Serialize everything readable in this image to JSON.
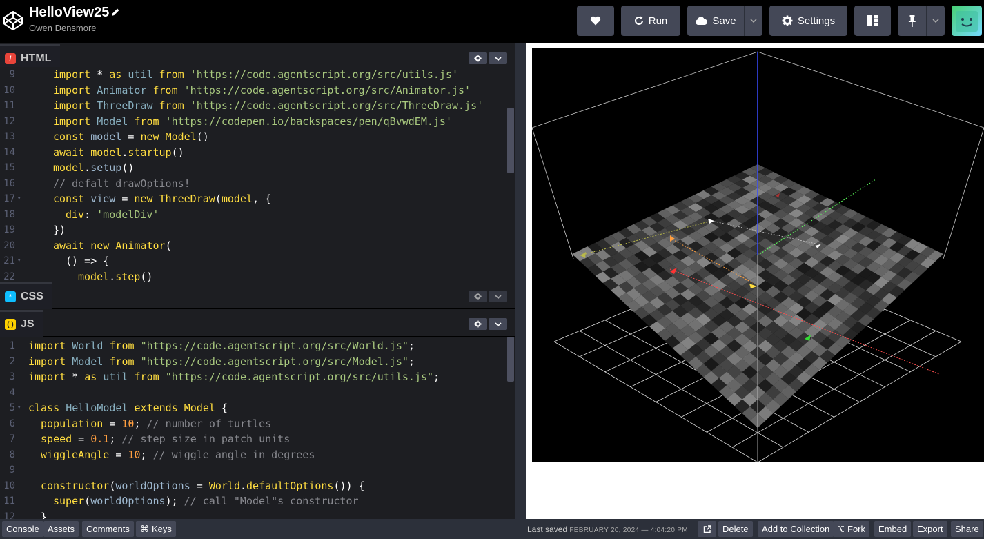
{
  "pen": {
    "title": "HelloView25",
    "author": "Owen Densmore"
  },
  "header_buttons": {
    "heart": "heart-icon",
    "run": "Run",
    "save": "Save",
    "settings": "Settings",
    "layout": "layout-icon",
    "pin": "pin-icon"
  },
  "panels": {
    "html": "HTML",
    "css": "CSS",
    "js": "JS"
  },
  "html_code": [
    {
      "n": "9",
      "fold": "",
      "indent": 2,
      "tokens": [
        [
          "kw",
          "import"
        ],
        [
          "punc",
          " * "
        ],
        [
          "kw",
          "as"
        ],
        [
          "punc",
          " "
        ],
        [
          "cls",
          "util"
        ],
        [
          "punc",
          " "
        ],
        [
          "kw",
          "from"
        ],
        [
          "punc",
          " "
        ],
        [
          "str",
          "'https://code.agentscript.org/src/utils.js'"
        ]
      ]
    },
    {
      "n": "10",
      "fold": "",
      "indent": 2,
      "tokens": [
        [
          "kw",
          "import"
        ],
        [
          "punc",
          " "
        ],
        [
          "cls",
          "Animator"
        ],
        [
          "punc",
          " "
        ],
        [
          "kw",
          "from"
        ],
        [
          "punc",
          " "
        ],
        [
          "str",
          "'https://code.agentscript.org/src/Animator.js'"
        ]
      ]
    },
    {
      "n": "11",
      "fold": "",
      "indent": 2,
      "tokens": [
        [
          "kw",
          "import"
        ],
        [
          "punc",
          " "
        ],
        [
          "cls",
          "ThreeDraw"
        ],
        [
          "punc",
          " "
        ],
        [
          "kw",
          "from"
        ],
        [
          "punc",
          " "
        ],
        [
          "str",
          "'https://code.agentscript.org/src/ThreeDraw.js'"
        ]
      ]
    },
    {
      "n": "12",
      "fold": "",
      "indent": 2,
      "tokens": [
        [
          "kw",
          "import"
        ],
        [
          "punc",
          " "
        ],
        [
          "cls",
          "Model"
        ],
        [
          "punc",
          " "
        ],
        [
          "kw",
          "from"
        ],
        [
          "punc",
          " "
        ],
        [
          "str",
          "'https://codepen.io/backspaces/pen/qBvwdEM.js'"
        ]
      ]
    },
    {
      "n": "13",
      "fold": "",
      "indent": 2,
      "tokens": [
        [
          "kw",
          "const"
        ],
        [
          "punc",
          " "
        ],
        [
          "var",
          "model"
        ],
        [
          "punc",
          " = "
        ],
        [
          "kw",
          "new"
        ],
        [
          "punc",
          " "
        ],
        [
          "fn",
          "Model"
        ],
        [
          "punc",
          "()"
        ]
      ]
    },
    {
      "n": "14",
      "fold": "",
      "indent": 2,
      "tokens": [
        [
          "kw",
          "await"
        ],
        [
          "punc",
          " "
        ],
        [
          "fn",
          "model"
        ],
        [
          "punc",
          "."
        ],
        [
          "fn",
          "startup"
        ],
        [
          "punc",
          "()"
        ]
      ]
    },
    {
      "n": "15",
      "fold": "",
      "indent": 2,
      "tokens": [
        [
          "fn",
          "model"
        ],
        [
          "punc",
          "."
        ],
        [
          "var",
          "setup"
        ],
        [
          "punc",
          "()"
        ]
      ]
    },
    {
      "n": "16",
      "fold": "",
      "indent": 2,
      "tokens": [
        [
          "cm",
          "// defalt drawOptions!"
        ]
      ]
    },
    {
      "n": "17",
      "fold": "▾",
      "indent": 2,
      "tokens": [
        [
          "kw",
          "const"
        ],
        [
          "punc",
          " "
        ],
        [
          "var",
          "view"
        ],
        [
          "punc",
          " = "
        ],
        [
          "kw",
          "new"
        ],
        [
          "punc",
          " "
        ],
        [
          "fn",
          "ThreeDraw"
        ],
        [
          "punc",
          "("
        ],
        [
          "fn",
          "model"
        ],
        [
          "punc",
          ", {"
        ]
      ]
    },
    {
      "n": "18",
      "fold": "",
      "indent": 3,
      "tokens": [
        [
          "fn",
          "div"
        ],
        [
          "punc",
          ": "
        ],
        [
          "str",
          "'modelDiv'"
        ]
      ]
    },
    {
      "n": "19",
      "fold": "",
      "indent": 2,
      "tokens": [
        [
          "punc",
          "})"
        ]
      ]
    },
    {
      "n": "20",
      "fold": "",
      "indent": 2,
      "tokens": [
        [
          "kw",
          "await"
        ],
        [
          "punc",
          " "
        ],
        [
          "kw",
          "new"
        ],
        [
          "punc",
          " "
        ],
        [
          "fn",
          "Animator"
        ],
        [
          "punc",
          "("
        ]
      ]
    },
    {
      "n": "21",
      "fold": "▾",
      "indent": 3,
      "tokens": [
        [
          "punc",
          "() => {"
        ]
      ]
    },
    {
      "n": "22",
      "fold": "",
      "indent": 4,
      "tokens": [
        [
          "fn",
          "model"
        ],
        [
          "punc",
          "."
        ],
        [
          "fn",
          "step"
        ],
        [
          "punc",
          "()"
        ]
      ]
    }
  ],
  "js_code": [
    {
      "n": "1",
      "fold": "",
      "indent": 0,
      "tokens": [
        [
          "kw",
          "import"
        ],
        [
          "punc",
          " "
        ],
        [
          "cls",
          "World"
        ],
        [
          "punc",
          " "
        ],
        [
          "kw",
          "from"
        ],
        [
          "punc",
          " "
        ],
        [
          "str",
          "\"https://code.agentscript.org/src/World.js\""
        ],
        [
          "punc",
          ";"
        ]
      ]
    },
    {
      "n": "2",
      "fold": "",
      "indent": 0,
      "tokens": [
        [
          "kw",
          "import"
        ],
        [
          "punc",
          " "
        ],
        [
          "cls",
          "Model"
        ],
        [
          "punc",
          " "
        ],
        [
          "kw",
          "from"
        ],
        [
          "punc",
          " "
        ],
        [
          "str",
          "\"https://code.agentscript.org/src/Model.js\""
        ],
        [
          "punc",
          ";"
        ]
      ]
    },
    {
      "n": "3",
      "fold": "",
      "indent": 0,
      "tokens": [
        [
          "kw",
          "import"
        ],
        [
          "punc",
          " * "
        ],
        [
          "kw",
          "as"
        ],
        [
          "punc",
          " "
        ],
        [
          "cls",
          "util"
        ],
        [
          "punc",
          " "
        ],
        [
          "kw",
          "from"
        ],
        [
          "punc",
          " "
        ],
        [
          "str",
          "\"https://code.agentscript.org/src/utils.js\""
        ],
        [
          "punc",
          ";"
        ]
      ]
    },
    {
      "n": "4",
      "fold": "",
      "indent": 0,
      "tokens": []
    },
    {
      "n": "5",
      "fold": "▾",
      "indent": 0,
      "tokens": [
        [
          "kw",
          "class"
        ],
        [
          "punc",
          " "
        ],
        [
          "cls",
          "HelloModel"
        ],
        [
          "punc",
          " "
        ],
        [
          "kw",
          "extends"
        ],
        [
          "punc",
          " "
        ],
        [
          "fn",
          "Model"
        ],
        [
          "punc",
          " {"
        ]
      ]
    },
    {
      "n": "6",
      "fold": "",
      "indent": 1,
      "tokens": [
        [
          "fn",
          "population"
        ],
        [
          "punc",
          " = "
        ],
        [
          "num",
          "10"
        ],
        [
          "punc",
          "; "
        ],
        [
          "cm",
          "// number of turtles"
        ]
      ]
    },
    {
      "n": "7",
      "fold": "",
      "indent": 1,
      "tokens": [
        [
          "fn",
          "speed"
        ],
        [
          "punc",
          " = "
        ],
        [
          "num",
          "0.1"
        ],
        [
          "punc",
          "; "
        ],
        [
          "cm",
          "// step size in patch units"
        ]
      ]
    },
    {
      "n": "8",
      "fold": "",
      "indent": 1,
      "tokens": [
        [
          "fn",
          "wiggleAngle"
        ],
        [
          "punc",
          " = "
        ],
        [
          "num",
          "10"
        ],
        [
          "punc",
          "; "
        ],
        [
          "cm",
          "// wiggle angle in degrees"
        ]
      ]
    },
    {
      "n": "9",
      "fold": "",
      "indent": 0,
      "tokens": []
    },
    {
      "n": "10",
      "fold": "",
      "indent": 1,
      "tokens": [
        [
          "fn",
          "constructor"
        ],
        [
          "punc",
          "("
        ],
        [
          "var",
          "worldOptions"
        ],
        [
          "punc",
          " = "
        ],
        [
          "fn",
          "World"
        ],
        [
          "punc",
          "."
        ],
        [
          "fn",
          "defaultOptions"
        ],
        [
          "punc",
          "()) {"
        ]
      ]
    },
    {
      "n": "11",
      "fold": "",
      "indent": 2,
      "tokens": [
        [
          "fn",
          "super"
        ],
        [
          "punc",
          "("
        ],
        [
          "var",
          "worldOptions"
        ],
        [
          "punc",
          "); "
        ],
        [
          "cm",
          "// call \"Model\"s constructor"
        ]
      ]
    },
    {
      "n": "12",
      "fold": "",
      "indent": 1,
      "tokens": [
        [
          "punc",
          "}"
        ]
      ]
    }
  ],
  "footer": {
    "console": "Console",
    "assets": "Assets",
    "comments": "Comments",
    "keys": "Keys",
    "keys_icon": "⌘",
    "saved_label": "Last saved",
    "saved_date": "FEBRUARY 20, 2024 — 4:04:20 PM",
    "delete": "Delete",
    "add_to_collection": "Add to Collection",
    "fork": "Fork",
    "embed": "Embed",
    "export": "Export",
    "share": "Share"
  },
  "colors": {
    "html_badge": "#e8443a",
    "css_badge": "#0ebeff",
    "js_badge": "#fcd000"
  }
}
